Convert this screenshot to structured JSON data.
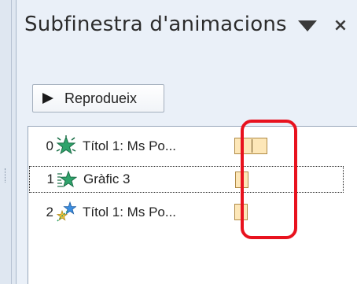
{
  "pane": {
    "title": "Subfinestra d'animacions",
    "background": "#eaf0f8"
  },
  "toolbar": {
    "play_label": "Reprodueix"
  },
  "animation_list": {
    "items": [
      {
        "number": "0",
        "name": "Títol 1: Ms Po...",
        "icon": "entrance-star-icon",
        "timing_fraction": 1.0,
        "selected": false
      },
      {
        "number": "1",
        "name": "Gràfic 3",
        "icon": "entrance-effect-star-icon",
        "timing_fraction": 0.4,
        "selected": true
      },
      {
        "number": "2",
        "name": "Títol 1: Ms Po...",
        "icon": "motion-stars-icon",
        "timing_fraction": 0.4,
        "selected": false
      }
    ]
  },
  "colors": {
    "highlight": "#e8121e",
    "timing_bar": "#fde7b8",
    "star_green": "#2fa36b"
  }
}
